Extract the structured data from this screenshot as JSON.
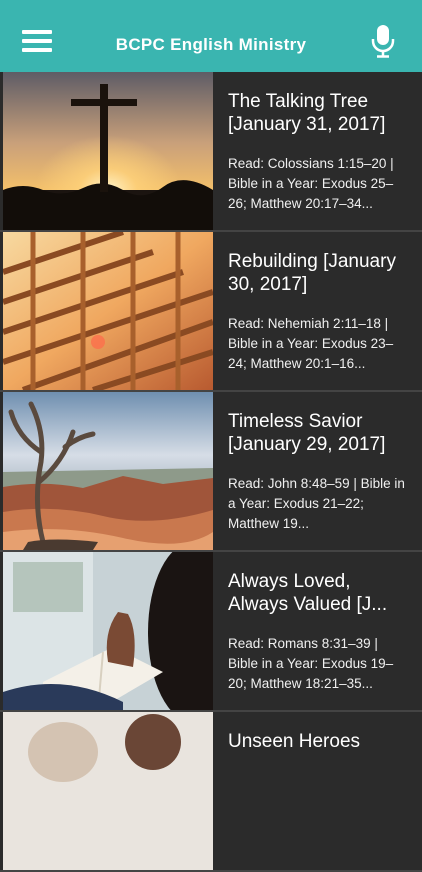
{
  "header": {
    "title": "BCPC English Ministry",
    "menu_icon": "hamburger-menu-icon",
    "mic_icon": "microphone-icon",
    "bg_color": "#3ab5b0"
  },
  "posts": [
    {
      "title": "The Talking Tree [January 31, 2017]",
      "description": "Read: Colossians 1:15–20 | Bible in a Year: Exodus 25–26; Matthew 20:17–34..."
    },
    {
      "title": "Rebuilding [January 30, 2017]",
      "description": "Read: Nehemiah 2:11–18 | Bible in a Year: Exodus 23–24; Matthew 20:1–16..."
    },
    {
      "title": "Timeless Savior [January 29, 2017]",
      "description": "Read: John 8:48–59 | Bible in a Year: Exodus 21–22; Matthew 19..."
    },
    {
      "title": "Always Loved, Always Valued [J...",
      "description": "Read: Romans 8:31–39 | Bible in a Year: Exodus 19–20; Matthew 18:21–35..."
    },
    {
      "title": "Unseen Heroes",
      "description": ""
    }
  ]
}
